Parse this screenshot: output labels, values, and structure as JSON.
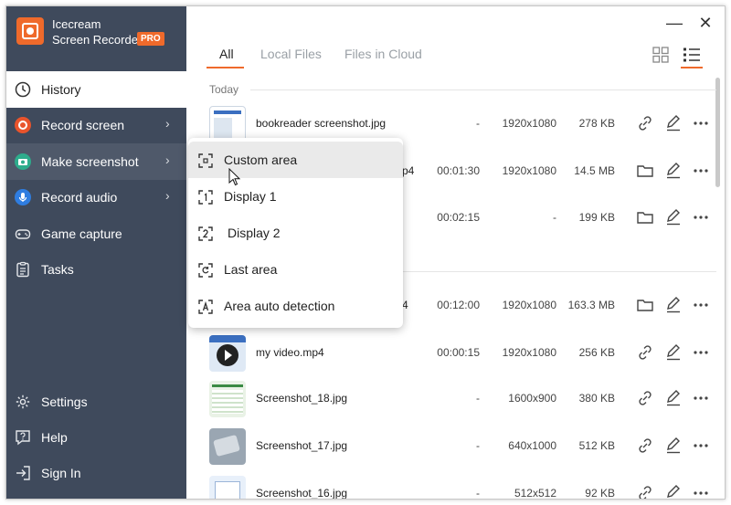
{
  "app": {
    "name_line1": "Icecream",
    "name_line2": "Screen Recorder",
    "badge": "PRO"
  },
  "colors": {
    "sidebar": "#3f4a5c",
    "accent": "#ef6a2b",
    "record_red": "#e9542c",
    "screenshot_green": "#2eac8c",
    "audio_blue": "#2f7de0"
  },
  "sidebar": {
    "items": [
      {
        "label": "History",
        "icon": "clock-icon"
      },
      {
        "label": "Record screen",
        "icon": "record-icon"
      },
      {
        "label": "Make screenshot",
        "icon": "camera-icon"
      },
      {
        "label": "Record audio",
        "icon": "microphone-icon"
      },
      {
        "label": "Game capture",
        "icon": "gamepad-icon"
      },
      {
        "label": "Tasks",
        "icon": "tasks-icon"
      }
    ],
    "bottom": [
      {
        "label": "Settings",
        "icon": "gear-icon"
      },
      {
        "label": "Help",
        "icon": "help-icon"
      },
      {
        "label": "Sign In",
        "icon": "sign-in-icon"
      }
    ]
  },
  "window": {
    "minimize": "—",
    "close": "✕"
  },
  "tabs": [
    "All",
    "Local Files",
    "Files in Cloud"
  ],
  "view_modes": [
    "grid-view-icon",
    "list-view-icon"
  ],
  "history": {
    "group_today": "Today",
    "rows": [
      {
        "name": "bookreader screenshot.jpg",
        "duration": "-",
        "resolution": "1920x1080",
        "size": "278 KB",
        "action1": "link-icon"
      },
      {
        "name": "p4",
        "duration": "00:01:30",
        "resolution": "1920x1080",
        "size": "14.5 MB",
        "action1": "folder-icon"
      },
      {
        "name": "",
        "duration": "00:02:15",
        "resolution": "-",
        "size": "199 KB",
        "action1": "folder-icon"
      },
      {
        "name": "4",
        "duration": "00:12:00",
        "resolution": "1920x1080",
        "size": "163.3 MB",
        "action1": "folder-icon"
      },
      {
        "name": "my video.mp4",
        "duration": "00:00:15",
        "resolution": "1920x1080",
        "size": "256 KB",
        "action1": "link-icon"
      },
      {
        "name": "Screenshot_18.jpg",
        "duration": "-",
        "resolution": "1600x900",
        "size": "380 KB",
        "action1": "link-icon"
      },
      {
        "name": "Screenshot_17.jpg",
        "duration": "-",
        "resolution": "640x1000",
        "size": "512 KB",
        "action1": "link-icon"
      },
      {
        "name": "Screenshot_16.jpg",
        "duration": "-",
        "resolution": "512x512",
        "size": "92 KB",
        "action1": "link-icon"
      }
    ]
  },
  "screenshot_menu": {
    "items": [
      {
        "label": "Custom area",
        "icon": "custom-area-icon"
      },
      {
        "label": "Display 1",
        "icon": "display-1-icon"
      },
      {
        "label": "Display 2",
        "icon": "display-2-icon"
      },
      {
        "label": "Last area",
        "icon": "last-area-icon"
      },
      {
        "label": "Area auto detection",
        "icon": "auto-detect-icon"
      }
    ]
  }
}
